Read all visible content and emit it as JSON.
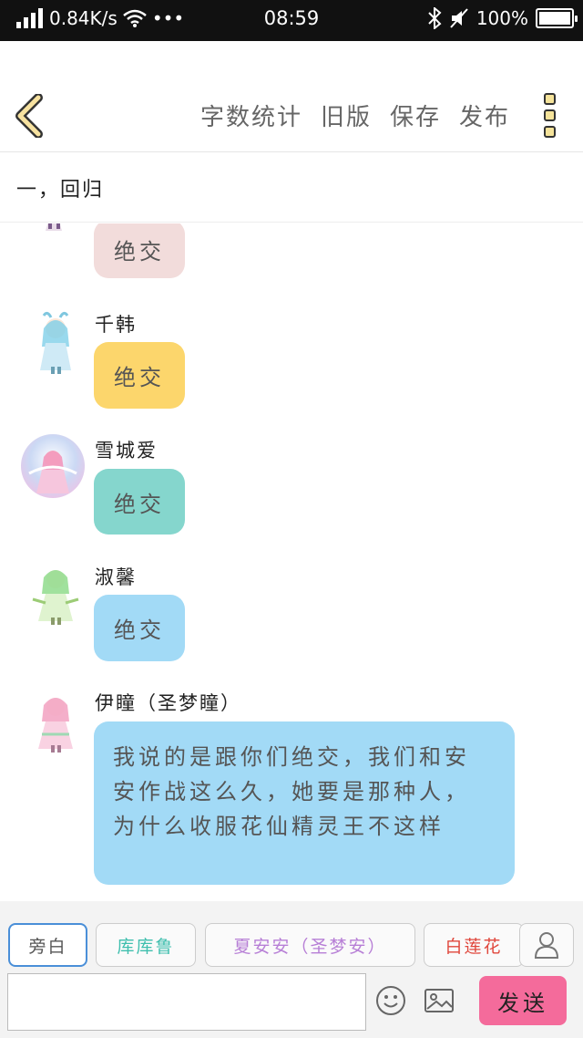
{
  "status_bar": {
    "speed": "0.84K/s",
    "dots": "•••",
    "time": "08:59",
    "battery": "100%"
  },
  "header": {
    "actions": [
      "字数统计",
      "旧版",
      "保存",
      "发布"
    ]
  },
  "chapter": {
    "title": "一，回归"
  },
  "messages": [
    {
      "name": "",
      "text": "绝交",
      "bubble_color": "#f2dcdb"
    },
    {
      "name": "千韩",
      "text": "绝交",
      "bubble_color": "#fcd66c"
    },
    {
      "name": "雪城爱",
      "text": "绝交",
      "bubble_color": "#85d6cd"
    },
    {
      "name": "淑馨",
      "text": "绝交",
      "bubble_color": "#a2daf6"
    },
    {
      "name": "伊瞳（圣梦瞳）",
      "text": "我说的是跟你们绝交，我们和安安作战这么久，她要是那种人，为什么收服花仙精灵王不这样",
      "bubble_color": "#a2daf6"
    }
  ],
  "characters": [
    {
      "label": "旁白",
      "color": "#555555"
    },
    {
      "label": "库库鲁",
      "color": "#3fbfae"
    },
    {
      "label": "夏安安（圣梦安）",
      "color": "#b77fd6"
    },
    {
      "label": "白莲花",
      "color": "#e0473c"
    }
  ],
  "composer": {
    "input_value": "",
    "send_label": "发送"
  },
  "icons": {
    "back": "chevron-left-icon",
    "more": "more-vertical-icon",
    "user": "user-icon",
    "emoji": "emoji-icon",
    "image": "image-icon"
  }
}
